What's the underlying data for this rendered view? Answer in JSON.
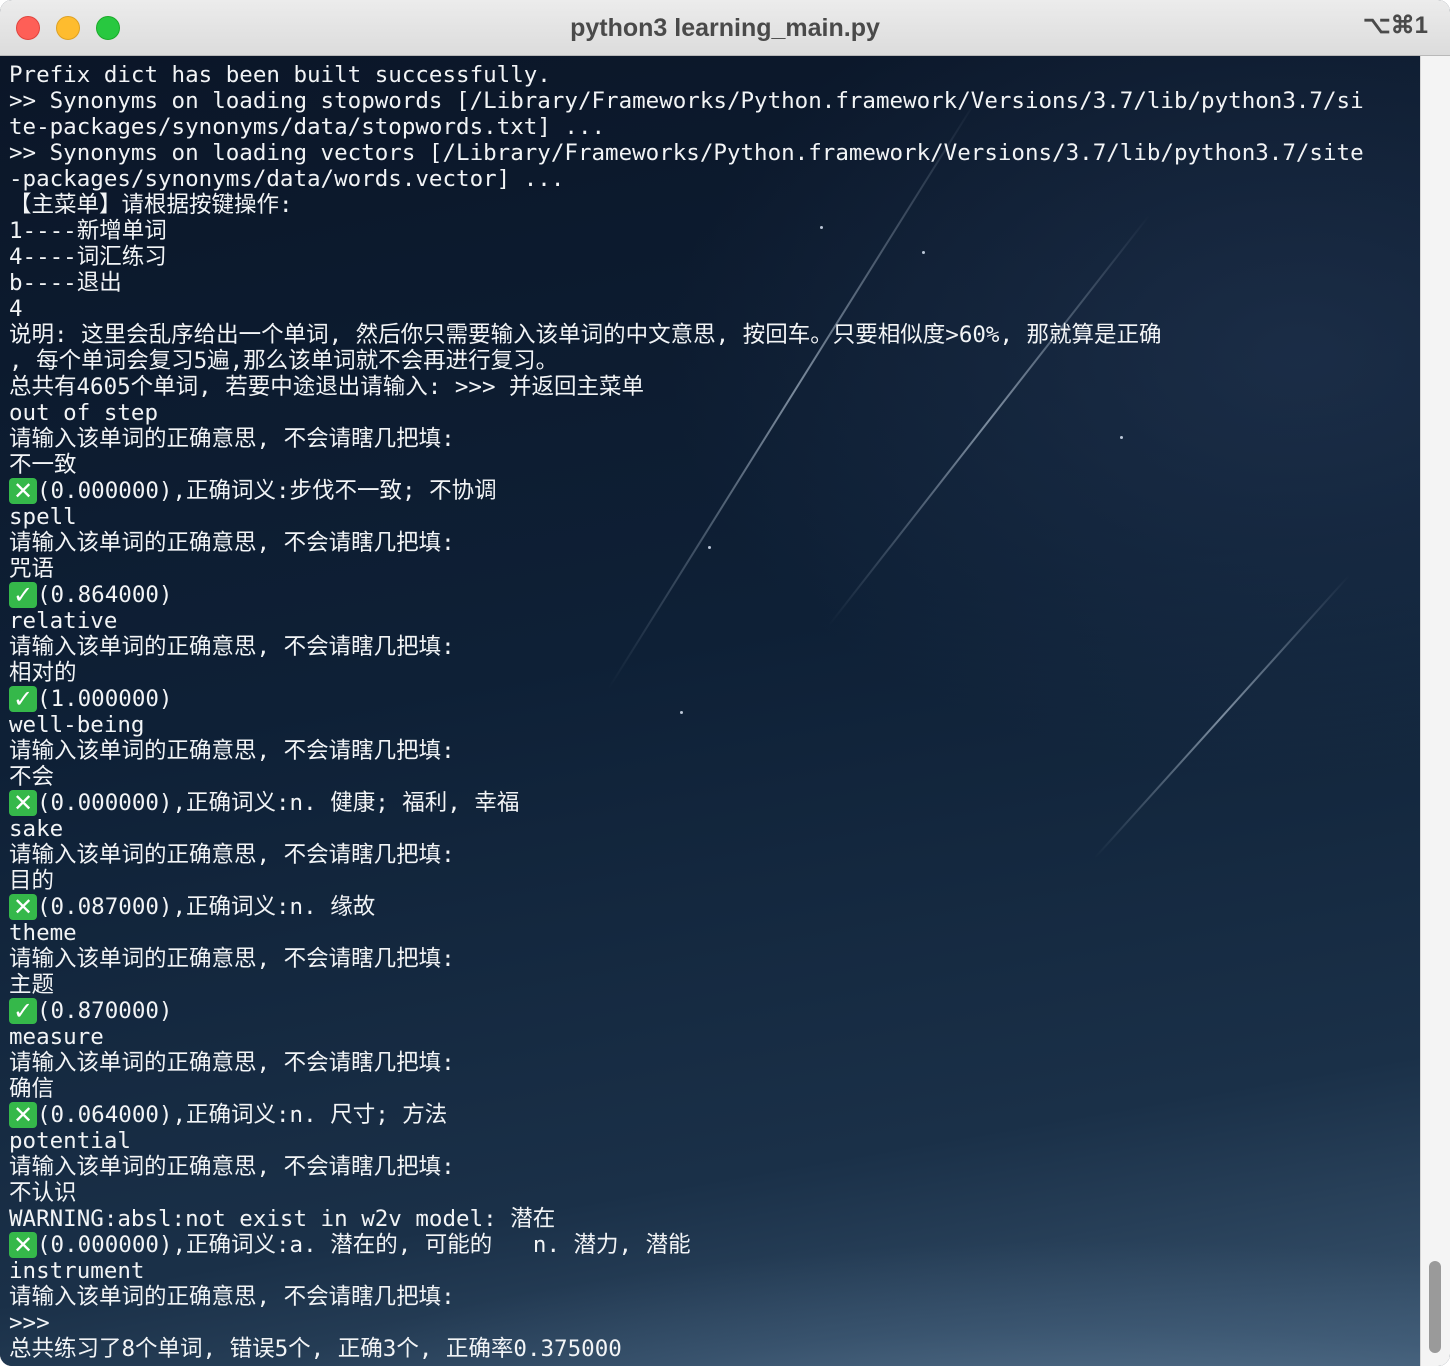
{
  "window": {
    "title": "python3 learning_main.py",
    "shortcut": "⌥⌘1"
  },
  "colors": {
    "close": "#fe5f57",
    "minimize": "#febc2e",
    "maximize": "#28c840",
    "text": "#f2f4f6",
    "mark_bg": "#35b84a"
  },
  "terminal": {
    "lines": [
      {
        "text": "Prefix dict has been built successfully."
      },
      {
        "text": ">> Synonyms on loading stopwords [/Library/Frameworks/Python.framework/Versions/3.7/lib/python3.7/si"
      },
      {
        "text": "te-packages/synonyms/data/stopwords.txt] ..."
      },
      {
        "text": ">> Synonyms on loading vectors [/Library/Frameworks/Python.framework/Versions/3.7/lib/python3.7/site"
      },
      {
        "text": "-packages/synonyms/data/words.vector] ..."
      },
      {
        "text": "【主菜单】请根据按键操作:"
      },
      {
        "text": "1----新增单词"
      },
      {
        "text": "4----词汇练习"
      },
      {
        "text": "b----退出"
      },
      {
        "text": "4"
      },
      {
        "text": "说明: 这里会乱序给出一个单词, 然后你只需要输入该单词的中文意思, 按回车。只要相似度>60%, 那就算是正确"
      },
      {
        "text": ", 每个单词会复习5遍,那么该单词就不会再进行复习。"
      },
      {
        "text": "总共有4605个单词, 若要中途退出请输入: >>> 并返回主菜单"
      },
      {
        "text": "out of step"
      },
      {
        "text": "请输入该单词的正确意思, 不会请瞎几把填:"
      },
      {
        "text": "不一致"
      },
      {
        "mark": "✕",
        "text": "(0.000000),正确词义:步伐不一致; 不协调"
      },
      {
        "text": "spell"
      },
      {
        "text": "请输入该单词的正确意思, 不会请瞎几把填:"
      },
      {
        "text": "咒语"
      },
      {
        "mark": "✓",
        "text": "(0.864000)"
      },
      {
        "text": "relative"
      },
      {
        "text": "请输入该单词的正确意思, 不会请瞎几把填:"
      },
      {
        "text": "相对的"
      },
      {
        "mark": "✓",
        "text": "(1.000000)"
      },
      {
        "text": "well-being"
      },
      {
        "text": "请输入该单词的正确意思, 不会请瞎几把填:"
      },
      {
        "text": "不会"
      },
      {
        "mark": "✕",
        "text": "(0.000000),正确词义:n. 健康; 福利, 幸福"
      },
      {
        "text": "sake"
      },
      {
        "text": "请输入该单词的正确意思, 不会请瞎几把填:"
      },
      {
        "text": "目的"
      },
      {
        "mark": "✕",
        "text": "(0.087000),正确词义:n. 缘故"
      },
      {
        "text": "theme"
      },
      {
        "text": "请输入该单词的正确意思, 不会请瞎几把填:"
      },
      {
        "text": "主题"
      },
      {
        "mark": "✓",
        "text": "(0.870000)"
      },
      {
        "text": "measure"
      },
      {
        "text": "请输入该单词的正确意思, 不会请瞎几把填:"
      },
      {
        "text": "确信"
      },
      {
        "mark": "✕",
        "text": "(0.064000),正确词义:n. 尺寸; 方法"
      },
      {
        "text": "potential"
      },
      {
        "text": "请输入该单词的正确意思, 不会请瞎几把填:"
      },
      {
        "text": "不认识"
      },
      {
        "text": "WARNING:absl:not exist in w2v model: 潜在"
      },
      {
        "mark": "✕",
        "text": "(0.000000),正确词义:a. 潜在的, 可能的   n. 潜力, 潜能"
      },
      {
        "text": "instrument"
      },
      {
        "text": "请输入该单词的正确意思, 不会请瞎几把填:"
      },
      {
        "text": ">>>"
      },
      {
        "text": "总共练习了8个单词, 错误5个, 正确3个, 正确率0.375000"
      }
    ]
  }
}
